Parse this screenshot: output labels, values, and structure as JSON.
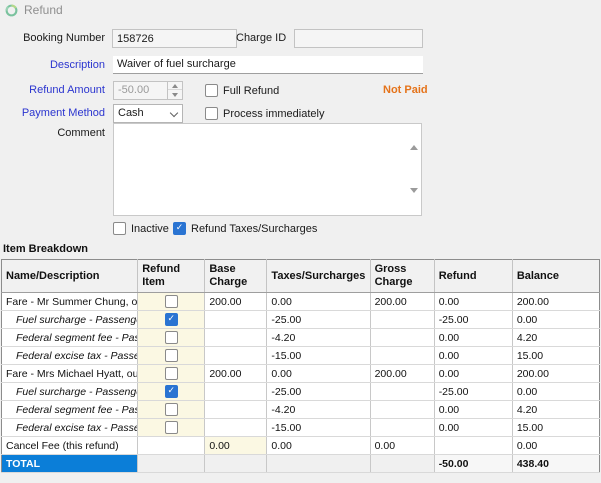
{
  "header": {
    "title": "Refund",
    "icon": "refund-circle-icon"
  },
  "form": {
    "booking_number": {
      "label": "Booking Number",
      "value": "158726"
    },
    "charge_id": {
      "label": "Charge ID",
      "value": ""
    },
    "description": {
      "label": "Description",
      "value": "Waiver of fuel surcharge"
    },
    "refund_amount": {
      "label": "Refund Amount",
      "value": "-50.00"
    },
    "full_refund": {
      "label": "Full Refund",
      "checked": false
    },
    "not_paid": "Not Paid",
    "payment_method": {
      "label": "Payment Method",
      "value": "Cash"
    },
    "process_immediately": {
      "label": "Process immediately",
      "checked": false
    },
    "comment": {
      "label": "Comment",
      "value": ""
    },
    "inactive": {
      "label": "Inactive",
      "checked": false
    },
    "refund_taxes": {
      "label": "Refund Taxes/Surcharges",
      "checked": true
    }
  },
  "breakdown": {
    "title": "Item Breakdown",
    "columns": [
      "Name/Description",
      "Refund Item",
      "Base Charge",
      "Taxes/Surcharges",
      "Gross Charge",
      "Refund",
      "Balance"
    ],
    "rows": [
      {
        "name": "Fare - Mr Summer Chung, outgoing",
        "indent": false,
        "check": "unchecked",
        "base": "200.00",
        "taxes": "0.00",
        "gross": "200.00",
        "refund": "0.00",
        "balance": "200.00",
        "base_editable": false
      },
      {
        "name": "Fuel surcharge - Passengers",
        "indent": true,
        "check": "checked",
        "base": "",
        "taxes": "-25.00",
        "gross": "",
        "refund": "-25.00",
        "balance": "0.00",
        "base_editable": false
      },
      {
        "name": "Federal segment fee - Passengers",
        "indent": true,
        "check": "unchecked",
        "base": "",
        "taxes": "-4.20",
        "gross": "",
        "refund": "0.00",
        "balance": "4.20",
        "base_editable": false
      },
      {
        "name": "Federal excise tax - Passengers",
        "indent": true,
        "check": "unchecked",
        "base": "",
        "taxes": "-15.00",
        "gross": "",
        "refund": "0.00",
        "balance": "15.00",
        "base_editable": false
      },
      {
        "name": "Fare - Mrs Michael Hyatt, outgoing",
        "indent": false,
        "check": "unchecked",
        "base": "200.00",
        "taxes": "0.00",
        "gross": "200.00",
        "refund": "0.00",
        "balance": "200.00",
        "base_editable": false
      },
      {
        "name": "Fuel surcharge - Passengers",
        "indent": true,
        "check": "checked",
        "base": "",
        "taxes": "-25.00",
        "gross": "",
        "refund": "-25.00",
        "balance": "0.00",
        "base_editable": false
      },
      {
        "name": "Federal segment fee - Passengers",
        "indent": true,
        "check": "unchecked",
        "base": "",
        "taxes": "-4.20",
        "gross": "",
        "refund": "0.00",
        "balance": "4.20",
        "base_editable": false
      },
      {
        "name": "Federal excise tax - Passengers",
        "indent": true,
        "check": "unchecked",
        "base": "",
        "taxes": "-15.00",
        "gross": "",
        "refund": "0.00",
        "balance": "15.00",
        "base_editable": false
      },
      {
        "name": "Cancel Fee (this refund)",
        "indent": false,
        "check": "none",
        "base": "0.00",
        "taxes": "0.00",
        "gross": "0.00",
        "refund": "",
        "balance": "0.00",
        "base_editable": true
      }
    ],
    "total": {
      "name": "TOTAL",
      "refund": "-50.00",
      "balance": "438.40"
    }
  },
  "colors": {
    "label_blue": "#2b35cf",
    "not_paid_orange": "#e5731a",
    "total_row_blue": "#0b7ed8",
    "checkbox_blue": "#2a74d2",
    "editable_cell_yellow": "#fbf8e3"
  }
}
